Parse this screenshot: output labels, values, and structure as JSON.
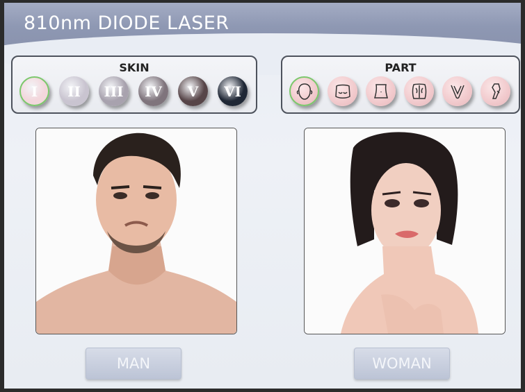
{
  "header": {
    "title": "810nm DIODE LASER"
  },
  "skin": {
    "label": "SKIN",
    "types": [
      {
        "label": "I",
        "color": "#f3d7dc",
        "selected": true
      },
      {
        "label": "II",
        "color": "#c9c4d0",
        "selected": false
      },
      {
        "label": "III",
        "color": "#a8a2ae",
        "selected": false
      },
      {
        "label": "IV",
        "color": "#7f747c",
        "selected": false
      },
      {
        "label": "V",
        "color": "#574548",
        "selected": false
      },
      {
        "label": "VI",
        "color": "#1f2735",
        "selected": false
      }
    ]
  },
  "part": {
    "label": "PART",
    "items": [
      {
        "icon": "face-icon",
        "selected": true
      },
      {
        "icon": "chest-icon",
        "selected": false
      },
      {
        "icon": "abdomen-icon",
        "selected": false
      },
      {
        "icon": "back-icon",
        "selected": false
      },
      {
        "icon": "bikini-icon",
        "selected": false
      },
      {
        "icon": "leg-icon",
        "selected": false
      }
    ]
  },
  "gender": {
    "man_label": "MAN",
    "woman_label": "WOMAN"
  }
}
